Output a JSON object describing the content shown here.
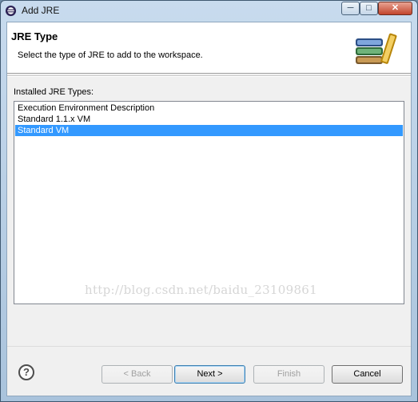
{
  "window": {
    "title": "Add JRE"
  },
  "banner": {
    "title": "JRE Type",
    "description": "Select the type of JRE to add to the workspace."
  },
  "list": {
    "label": "Installed JRE Types:",
    "items": [
      {
        "label": "Execution Environment Description",
        "selected": false
      },
      {
        "label": "Standard 1.1.x VM",
        "selected": false
      },
      {
        "label": "Standard VM",
        "selected": true
      }
    ]
  },
  "watermark": "http://blog.csdn.net/baidu_23109861",
  "buttons": {
    "help": "?",
    "back": "< Back",
    "next": "Next >",
    "finish": "Finish",
    "cancel": "Cancel"
  },
  "colors": {
    "selection": "#3399ff",
    "close_button": "#c2452d"
  }
}
